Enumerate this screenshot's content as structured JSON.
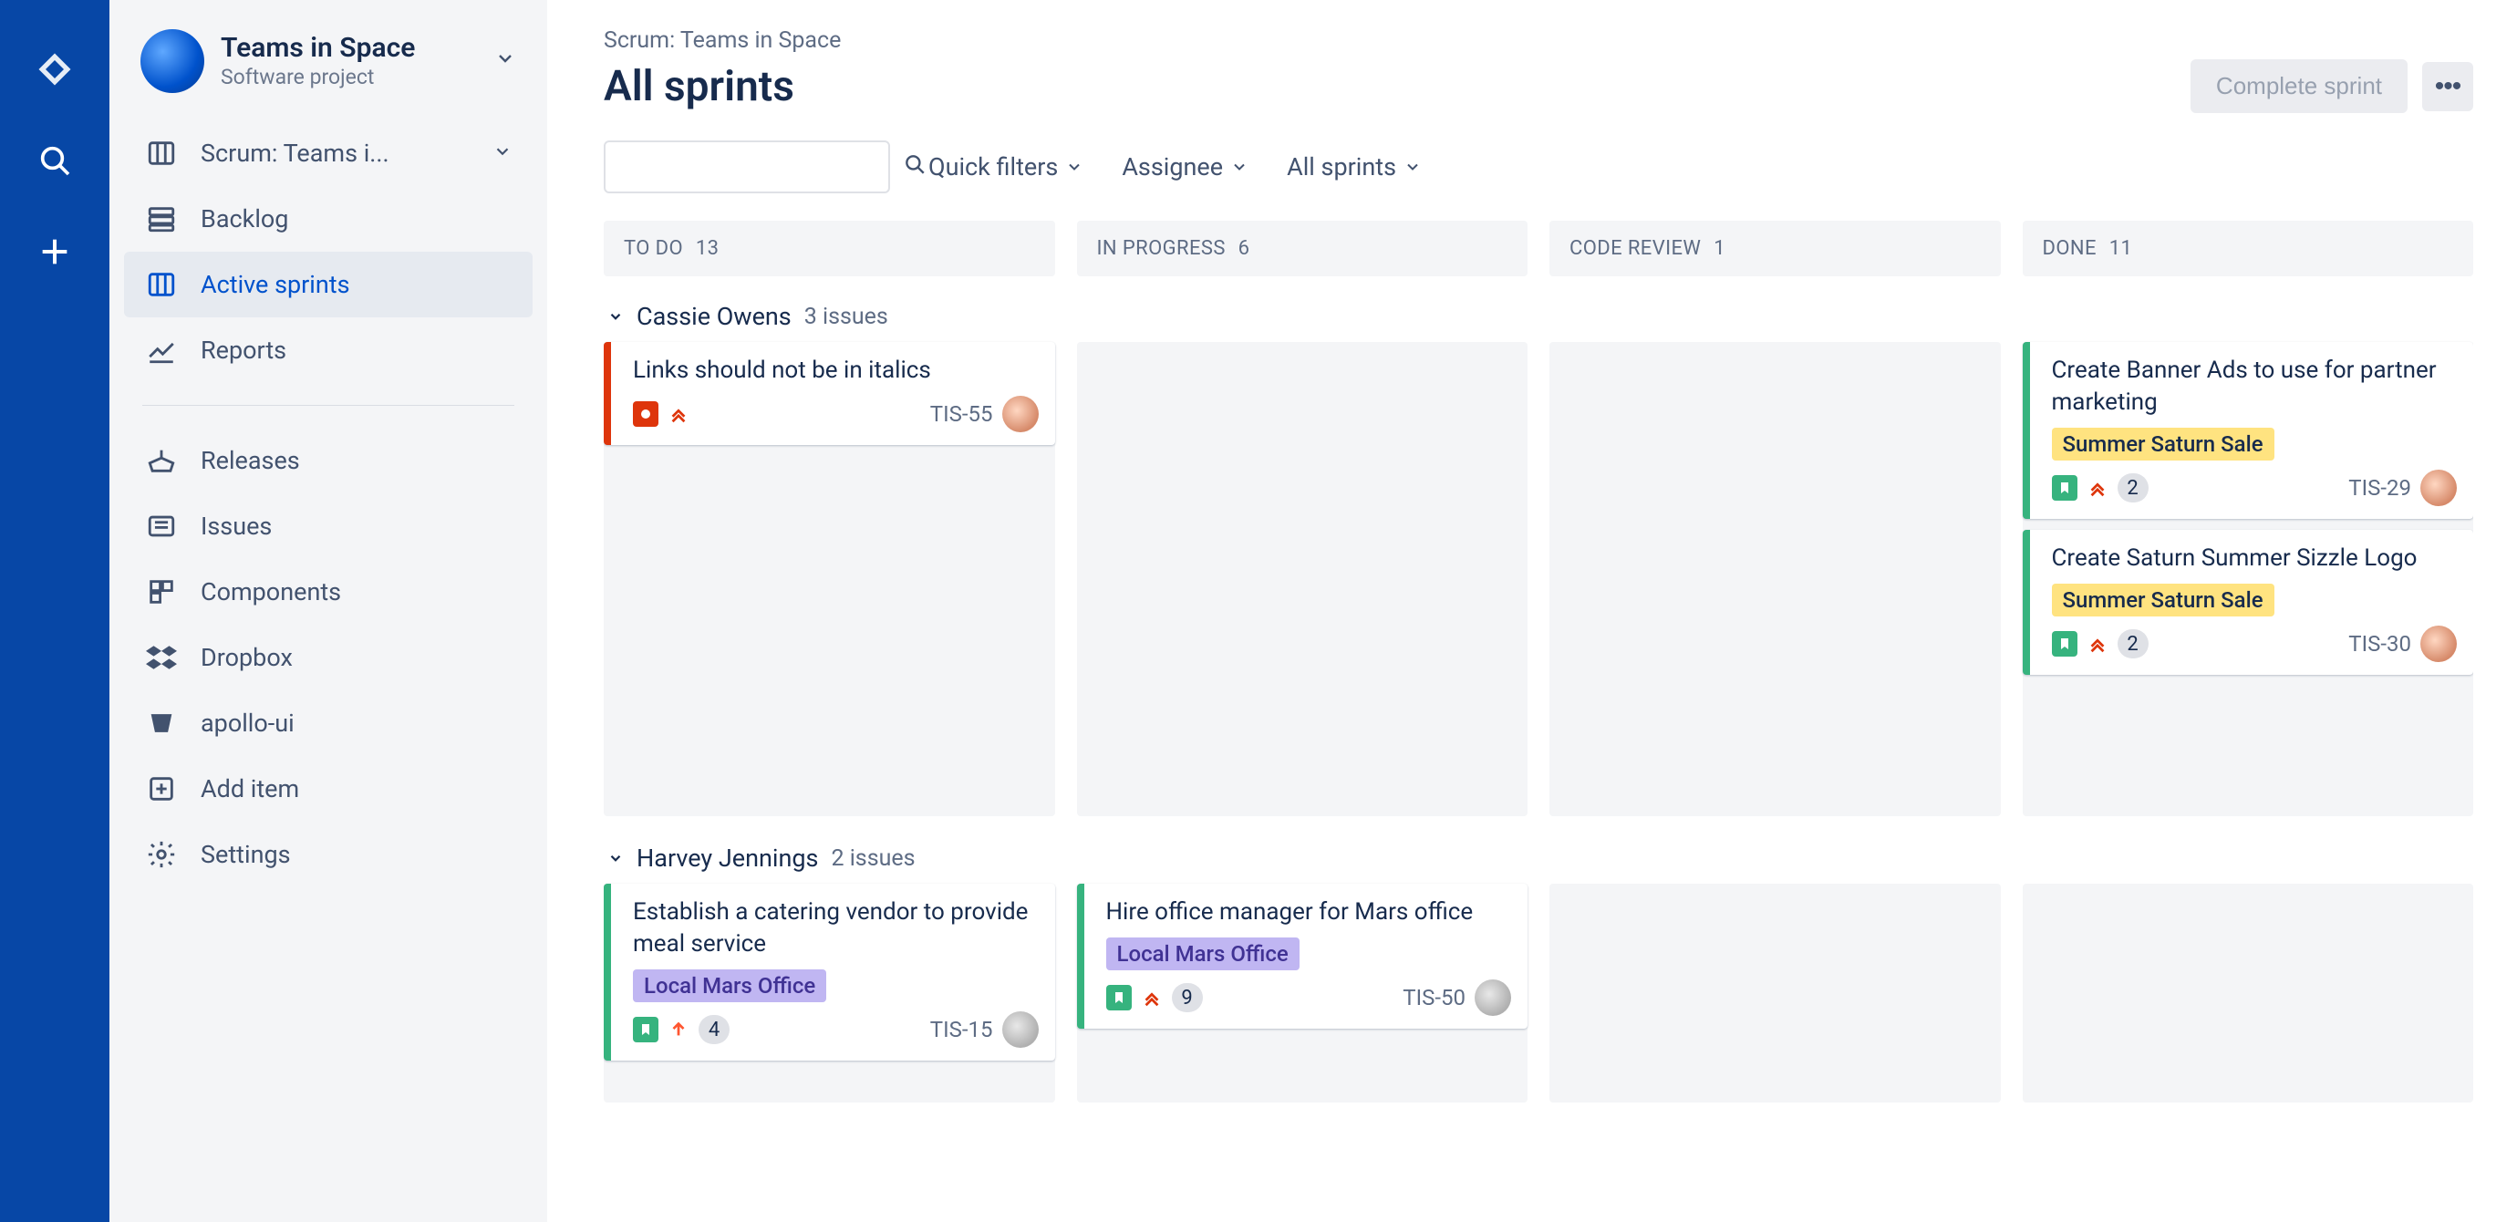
{
  "project": {
    "name": "Teams in Space",
    "subtitle": "Software project"
  },
  "sidebar": {
    "board_link": "Scrum: Teams i...",
    "items_top": [
      {
        "label": "Backlog"
      },
      {
        "label": "Active sprints"
      },
      {
        "label": "Reports"
      }
    ],
    "items_bottom": [
      {
        "label": "Releases"
      },
      {
        "label": "Issues"
      },
      {
        "label": "Components"
      },
      {
        "label": "Dropbox"
      },
      {
        "label": "apollo-ui"
      },
      {
        "label": "Add item"
      },
      {
        "label": "Settings"
      }
    ]
  },
  "breadcrumb": "Scrum: Teams in Space",
  "page_title": "All sprints",
  "actions": {
    "complete_sprint": "Complete sprint"
  },
  "filters": {
    "search_placeholder": "",
    "quick_filters": "Quick filters",
    "assignee": "Assignee",
    "all_sprints": "All sprints"
  },
  "columns": [
    {
      "name": "TO DO",
      "count": "13"
    },
    {
      "name": "IN PROGRESS",
      "count": "6"
    },
    {
      "name": "CODE REVIEW",
      "count": "1"
    },
    {
      "name": "DONE",
      "count": "11"
    }
  ],
  "swimlanes": [
    {
      "title": "Cassie Owens",
      "issues_label": "3 issues",
      "lanes": {
        "todo": [
          {
            "title": "Links should not be in italics",
            "type": "bug",
            "priority": "highest",
            "key": "TIS-55",
            "epic": null,
            "badge": null,
            "avatar": "a1"
          }
        ],
        "inprogress": [],
        "codereview": [],
        "done": [
          {
            "title": "Create Banner Ads to use for partner marketing",
            "type": "story",
            "priority": "highest",
            "key": "TIS-29",
            "epic": "Summer Saturn Sale",
            "epic_color": "yellow",
            "badge": "2",
            "avatar": "a1"
          },
          {
            "title": "Create Saturn Summer Sizzle Logo",
            "type": "story",
            "priority": "highest",
            "key": "TIS-30",
            "epic": "Summer Saturn Sale",
            "epic_color": "yellow",
            "badge": "2",
            "avatar": "a1"
          }
        ]
      }
    },
    {
      "title": "Harvey Jennings",
      "issues_label": "2 issues",
      "lanes": {
        "todo": [
          {
            "title": "Establish a catering vendor to provide meal service",
            "type": "story",
            "priority": "medium",
            "key": "TIS-15",
            "epic": "Local Mars Office",
            "epic_color": "purple",
            "badge": "4",
            "avatar": "a2"
          }
        ],
        "inprogress": [
          {
            "title": "Hire office manager for Mars office",
            "type": "story",
            "priority": "highest",
            "key": "TIS-50",
            "epic": "Local Mars Office",
            "epic_color": "purple",
            "badge": "9",
            "avatar": "a2"
          }
        ],
        "codereview": [],
        "done": []
      }
    }
  ]
}
